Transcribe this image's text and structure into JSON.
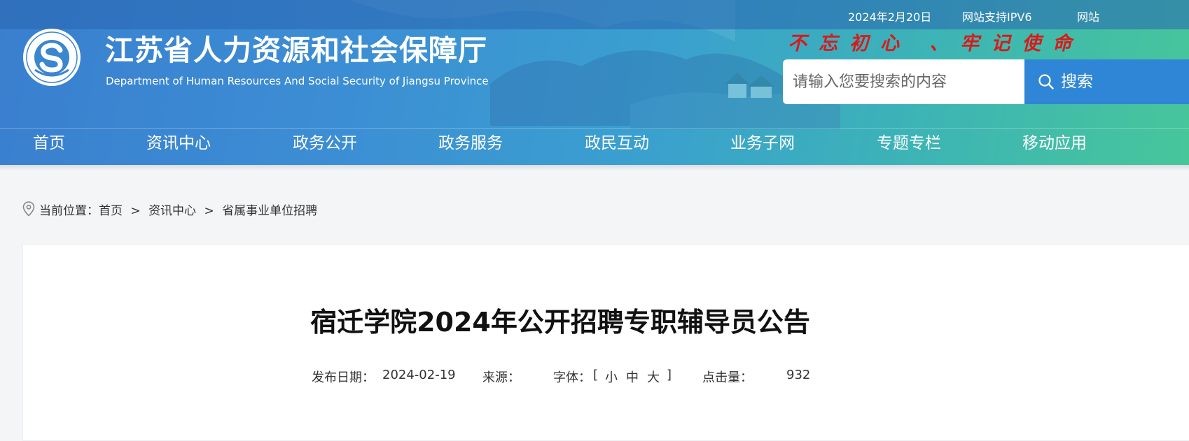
{
  "topbar": {
    "date": "2024年2月20日",
    "ipv6": "网站支持IPV6",
    "extra": "网站"
  },
  "site": {
    "name_cn": "江苏省人力资源和社会保障厅",
    "name_en": "Department of Human Resources And Social Security of Jiangsu Province",
    "slogan": "不忘初心 、牢记使命",
    "logo_icon": "department-emblem-icon"
  },
  "search": {
    "placeholder": "请输入您要搜索的内容",
    "button_label": "搜索",
    "icon": "search-icon"
  },
  "nav": {
    "items": [
      "首页",
      "资讯中心",
      "政务公开",
      "政务服务",
      "政民互动",
      "业务子网",
      "专题专栏",
      "移动应用"
    ]
  },
  "breadcrumb": {
    "prefix": "当前位置：",
    "items": [
      "首页",
      "资讯中心",
      "省属事业单位招聘"
    ],
    "separator": ">",
    "icon": "location-pin-icon"
  },
  "article": {
    "title": "宿迁学院2024年公开招聘专职辅导员公告",
    "date_label": "发布日期：",
    "date": "2024-02-19",
    "source_label": "来源：",
    "source": "",
    "font_label": "字体：",
    "font_open": "[",
    "font_sizes": [
      "小",
      "中",
      "大"
    ],
    "font_close": "]",
    "clicks_label": "点击量：",
    "clicks": "932"
  },
  "colors": {
    "header_start": "#3a7fcf",
    "header_end": "#47c69a",
    "slogan": "#d81a1a",
    "search_button": "#2f86d6"
  }
}
